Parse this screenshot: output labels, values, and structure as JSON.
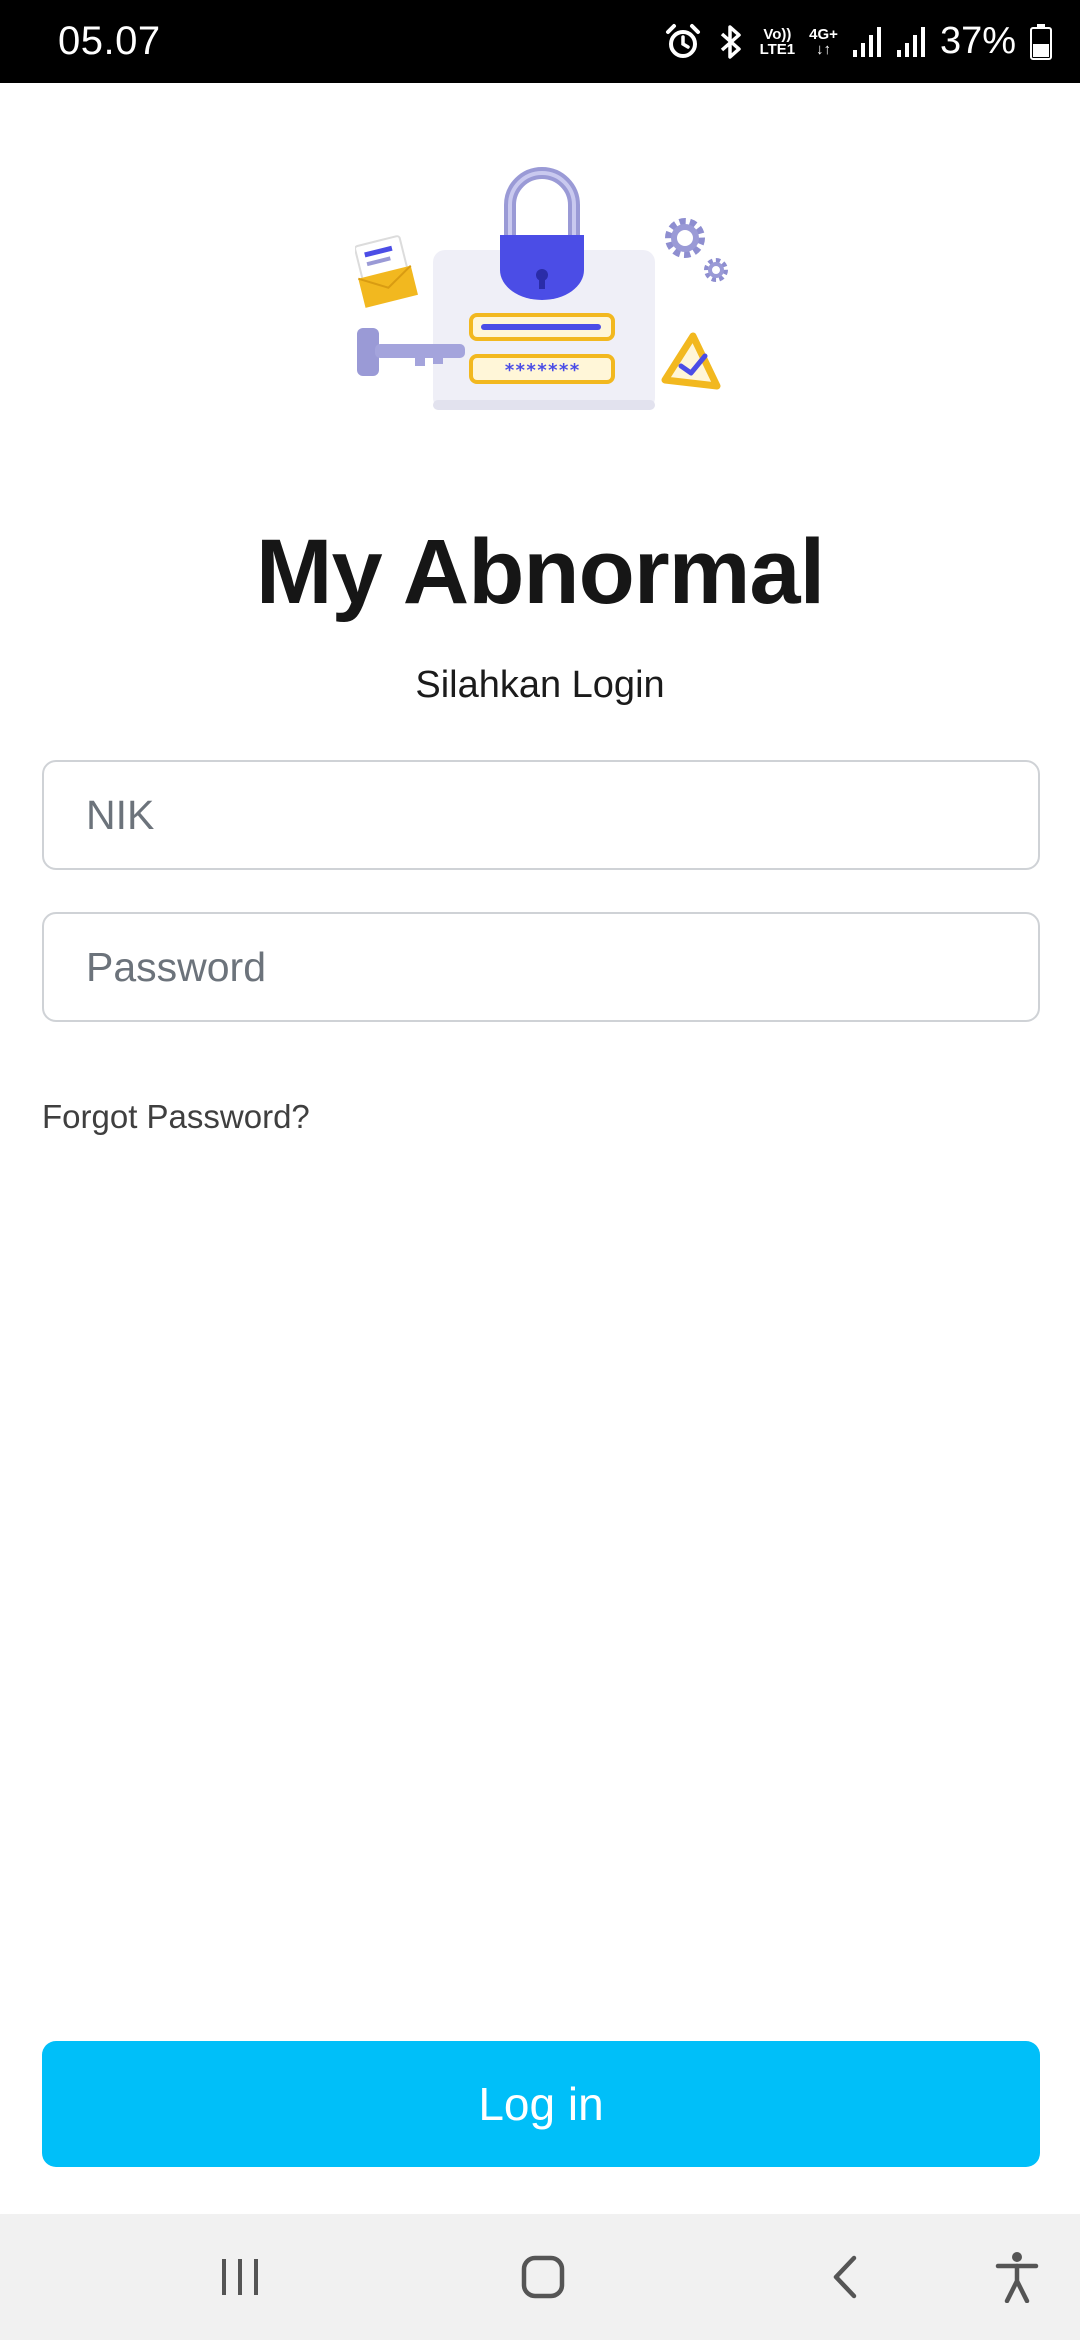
{
  "status_bar": {
    "time": "05.07",
    "volte_line1": "Vo))",
    "volte_line2": "LTE1",
    "network_type": "4G+",
    "battery_percent": "37%",
    "icons": [
      "alarm-icon",
      "bluetooth-icon",
      "volte-icon",
      "data-4g-icon",
      "signal-icon",
      "signal-icon",
      "battery-icon"
    ]
  },
  "header": {
    "title": "My Abnormal",
    "subtitle": "Silahkan Login"
  },
  "form": {
    "nik_placeholder": "NIK",
    "nik_value": "",
    "password_placeholder": "Password",
    "password_value": "",
    "forgot_label": "Forgot Password?",
    "login_label": "Log in"
  },
  "illustration": {
    "password_mask": "*******",
    "icons": [
      "padlock-icon",
      "key-icon",
      "envelope-icon",
      "gear-icon",
      "warning-check-icon"
    ]
  },
  "nav_bar": {
    "icons": [
      "recents-icon",
      "home-icon",
      "back-icon",
      "accessibility-icon"
    ]
  },
  "colors": {
    "accent": "#00bff9",
    "illustration_blue": "#4b4de6",
    "illustration_yellow": "#f2b81f",
    "illustration_lavender": "#9a9ad6"
  }
}
